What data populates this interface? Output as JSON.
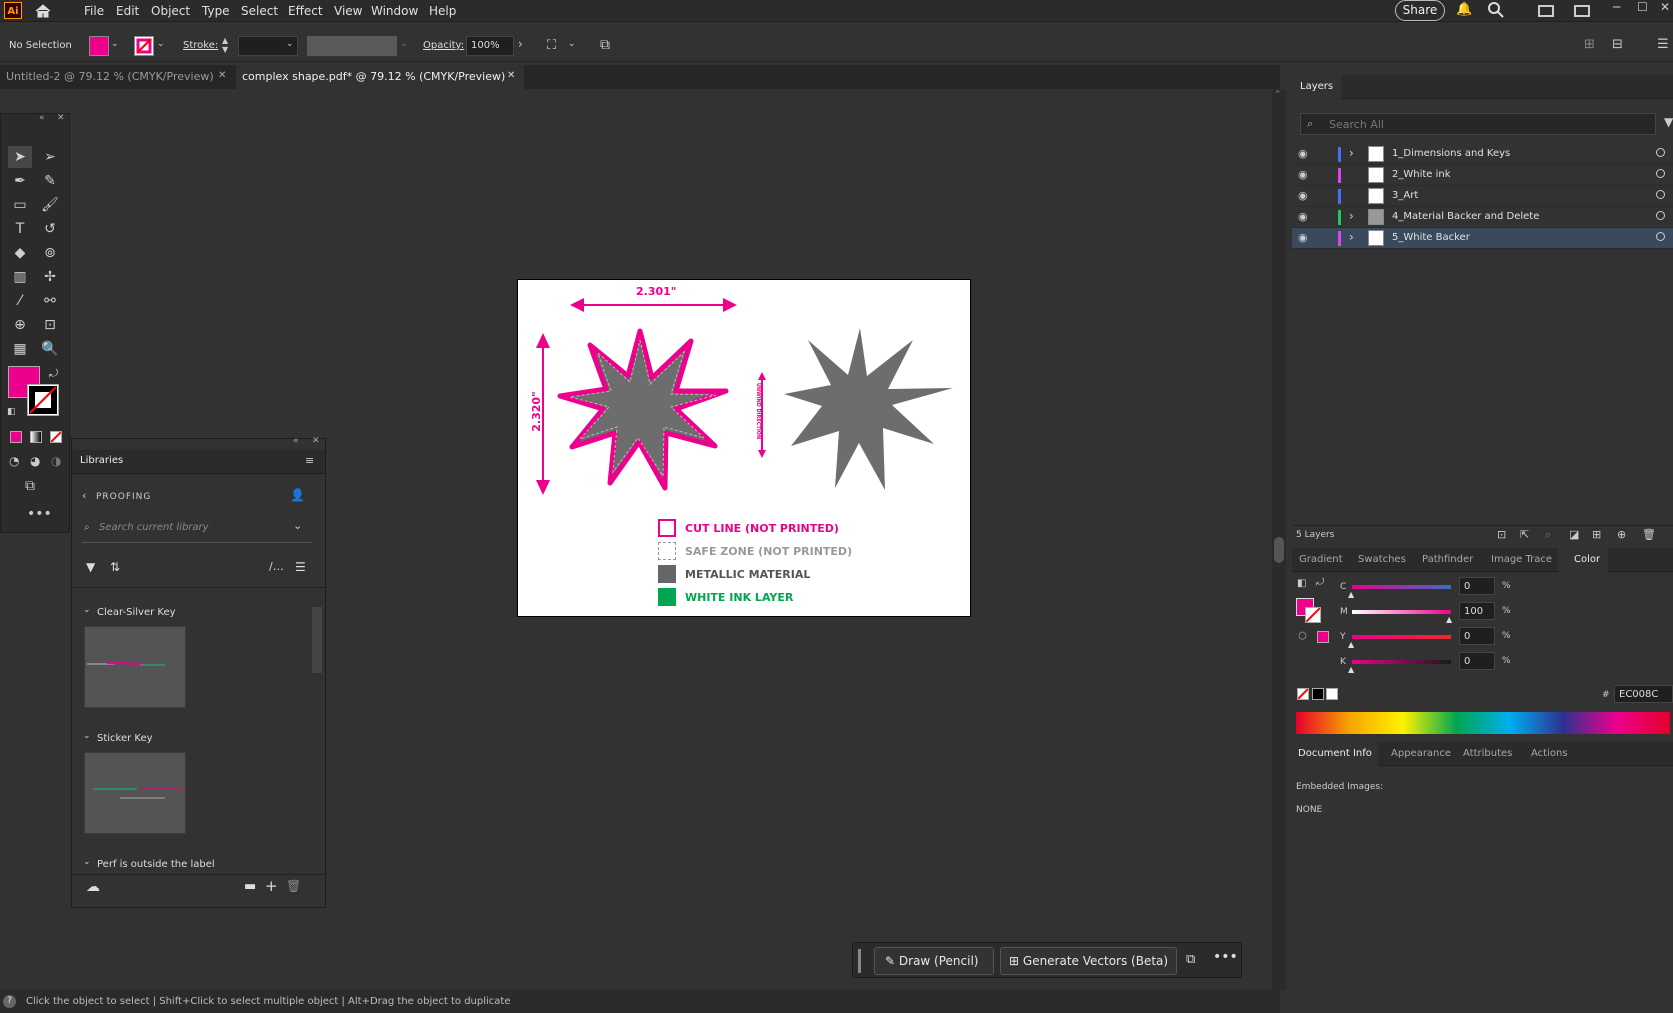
{
  "app": {
    "logo": "Ai"
  },
  "menu": [
    "File",
    "Edit",
    "Object",
    "Type",
    "Select",
    "Effect",
    "View",
    "Window",
    "Help"
  ],
  "topright": {
    "share": "Share"
  },
  "control": {
    "selection": "No Selection",
    "stroke_label": "Stroke:",
    "opacity_label": "Opacity:",
    "opacity_value": "100%",
    "fill_color": "#EC008C"
  },
  "tabs": [
    {
      "label": "Untitled-2 @ 79.12 % (CMYK/Preview)"
    },
    {
      "label": "complex shape.pdf* @ 79.12 % (CMYK/Preview)"
    }
  ],
  "libraries": {
    "title": "Libraries",
    "breadcrumb": "PROOFING",
    "search_placeholder": "Search current library",
    "groups": [
      "Clear-Silver Key",
      "Sticker Key",
      "Perf is outside the label"
    ]
  },
  "artboard": {
    "width_dim": "2.301\"",
    "height_dim": "2.320\"",
    "direction": "UNWIND DIRECTION",
    "legend": [
      {
        "label": "CUT LINE (NOT PRINTED)",
        "color": "#EC008C"
      },
      {
        "label": "SAFE ZONE (NOT PRINTED)",
        "color": "#999999"
      },
      {
        "label": "METALLIC MATERIAL",
        "color": "#555555"
      },
      {
        "label": "WHITE INK LAYER",
        "color": "#00A651"
      }
    ]
  },
  "layers": {
    "title": "Layers",
    "search_placeholder": "Search All",
    "items": [
      {
        "name": "1_Dimensions and Keys",
        "color": "#4a6cf7"
      },
      {
        "name": "2_White ink",
        "color": "#d946ef"
      },
      {
        "name": "3_Art",
        "color": "#4a6cf7"
      },
      {
        "name": "4_Material Backer and Delete",
        "color": "#22c55e"
      },
      {
        "name": "5_White Backer",
        "color": "#d946ef"
      }
    ],
    "count": "5 Layers"
  },
  "color_panel": {
    "tabs": [
      "Gradient",
      "Swatches",
      "Pathfinder",
      "Image Trace",
      "Color"
    ],
    "channels": [
      {
        "label": "C",
        "value": "0"
      },
      {
        "label": "M",
        "value": "100"
      },
      {
        "label": "Y",
        "value": "0"
      },
      {
        "label": "K",
        "value": "0"
      }
    ],
    "percent": "%",
    "hex_label": "#",
    "hex": "EC008C"
  },
  "doc_info": {
    "tabs": [
      "Document Info",
      "Appearance",
      "Attributes",
      "Actions"
    ],
    "embedded_label": "Embedded Images:",
    "embedded_value": "NONE"
  },
  "context_bar": {
    "draw": "Draw (Pencil)",
    "generate": "Generate Vectors (Beta)"
  },
  "status": {
    "hint": "Click the object to select  |  Shift+Click to select multiple object  |  Alt+Drag the object to duplicate"
  }
}
